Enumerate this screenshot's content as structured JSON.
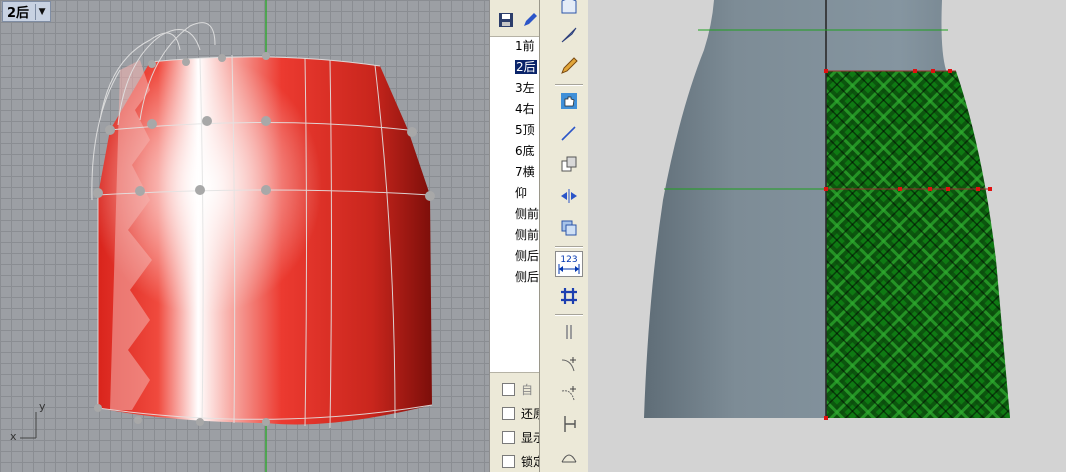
{
  "viewport": {
    "title": "2后",
    "axis_y": "y",
    "axis_x": "x"
  },
  "view_list": {
    "items": [
      "1前",
      "2后",
      "3左",
      "4右",
      "5顶",
      "6底",
      "7横",
      "仰",
      "侧前",
      "侧前",
      "侧后",
      "侧后"
    ],
    "selected": "2后"
  },
  "checkboxes": [
    {
      "label": "自",
      "dim": true
    },
    {
      "label": "还原",
      "dim": false
    },
    {
      "label": "显示",
      "dim": false
    },
    {
      "label": "锁定",
      "dim": false
    }
  ],
  "toolbar": {
    "dimension_label": "123"
  },
  "colors": {
    "skirt_red": "#e8332d",
    "plaid_green": "#0d7a0d",
    "mannequin": "#7e8d96"
  }
}
